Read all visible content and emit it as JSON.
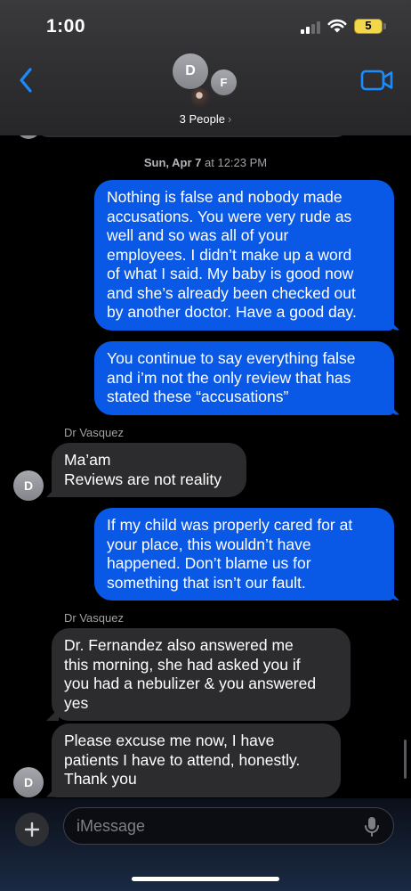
{
  "status_bar": {
    "time": "1:00",
    "battery": "5"
  },
  "header": {
    "avatars": [
      "D",
      "F"
    ],
    "participants_label": "3 People",
    "chevron": "›",
    "back_icon": "chevron-left-icon",
    "video_icon": "video-camera-icon"
  },
  "colors": {
    "accent": "#1a8cff",
    "sent_bubble": "#0a58e6",
    "received_bubble": "#2c2c2e",
    "battery": "#f2d64b"
  },
  "conversation": {
    "timestamp_day": "Sun, Apr 7",
    "timestamp_time": " at 12:23 PM",
    "messages": [
      {
        "type": "sent",
        "text": "Nothing is false and nobody made\naccusations. You were very rude as\nwell and so was all of your\nemployees. I didn’t make up a word\nof what I said. My baby is good now\nand she’s already been checked out\nby another doctor. Have a good day."
      },
      {
        "type": "sent",
        "text": "You continue to say everything false\nand i’m not the only review that has\nstated these “accusations”"
      },
      {
        "type": "received",
        "sender": "Dr Vasquez",
        "avatar": "D",
        "text": "Ma’am\nReviews are not reality"
      },
      {
        "type": "sent",
        "text": "If my child was properly cared for at\nyour place, this wouldn’t have\nhappened. Don’t blame us for\nsomething that isn’t our fault."
      },
      {
        "type": "received",
        "sender": "Dr Vasquez",
        "text": "Dr. Fernandez also answered me\nthis morning, she had asked you if\nyou had a nebulizer & you answered\nyes"
      },
      {
        "type": "received",
        "avatar": "D",
        "text": "Please excuse me now, I have\npatients I have to attend, honestly.\nThank you"
      }
    ]
  },
  "composer": {
    "placeholder": "iMessage",
    "plus_icon": "plus-icon",
    "mic_icon": "microphone-icon"
  }
}
